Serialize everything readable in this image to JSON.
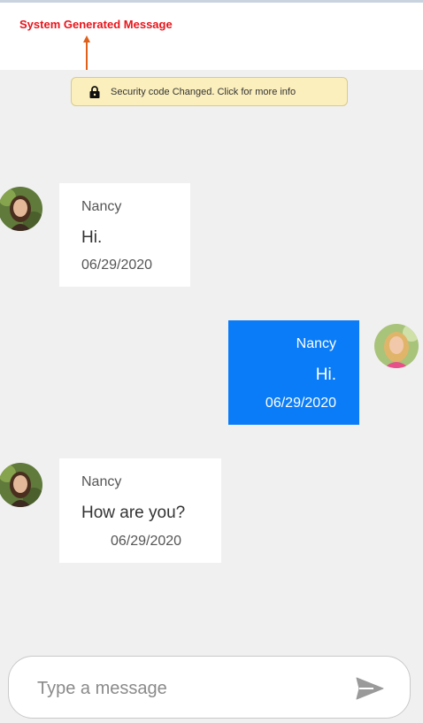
{
  "annotation": {
    "label": "System Generated Message"
  },
  "system_message": {
    "text": "Security code Changed. Click for more info",
    "icon": "lock-icon"
  },
  "messages": [
    {
      "direction": "incoming",
      "sender": "Nancy",
      "text": "Hi.",
      "timestamp": "06/29/2020"
    },
    {
      "direction": "outgoing",
      "sender": "Nancy",
      "text": "Hi.",
      "timestamp": "06/29/2020"
    },
    {
      "direction": "incoming",
      "sender": "Nancy",
      "text": "How are you?",
      "timestamp": "06/29/2020"
    }
  ],
  "composer": {
    "placeholder": "Type a message",
    "send_icon": "send-icon"
  },
  "colors": {
    "annotation": "#e8141b",
    "banner_bg": "#fbefbd",
    "outgoing_bubble": "#0a7cf7",
    "chat_bg": "#f0f0f0"
  }
}
